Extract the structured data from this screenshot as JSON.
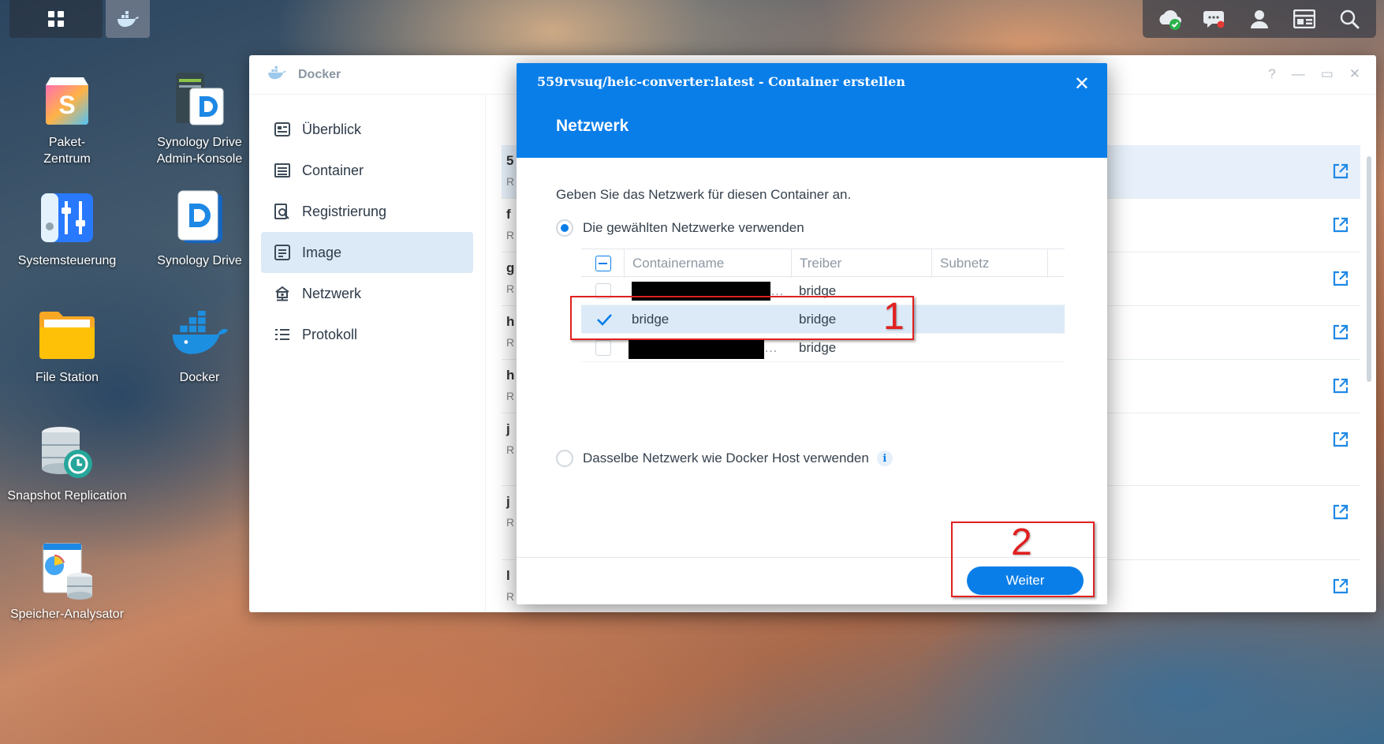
{
  "taskbar": {
    "icons": [
      "apps-grid-icon",
      "docker-app-icon",
      "cloud-sync-icon",
      "chat-notification-icon",
      "user-icon",
      "widgets-icon",
      "search-icon"
    ]
  },
  "desktop": {
    "icons": [
      {
        "label": "Paket-\nZentrum"
      },
      {
        "label": "Synology Drive\nAdmin-Konsole"
      },
      {
        "label": "Systemsteuerung"
      },
      {
        "label": "Synology Drive"
      },
      {
        "label": "File Station"
      },
      {
        "label": "Docker"
      },
      {
        "label": "Snapshot Replication"
      },
      {
        "label": "Speicher-Analysator"
      }
    ]
  },
  "docker_window": {
    "title": "Docker",
    "controls": [
      "?",
      "—",
      "▭",
      "✕"
    ],
    "sidebar": [
      {
        "label": "Überblick"
      },
      {
        "label": "Container"
      },
      {
        "label": "Registrierung"
      },
      {
        "label": "Image"
      },
      {
        "label": "Netzwerk"
      },
      {
        "label": "Protokoll"
      }
    ],
    "rows": [
      {
        "l1": "5",
        "l2": "R"
      },
      {
        "l1": "f",
        "l2": "R"
      },
      {
        "l1": "g",
        "l2": "R"
      },
      {
        "l1": "h",
        "l2": "R"
      },
      {
        "l1": "h",
        "l2": "R"
      },
      {
        "l1": "j",
        "l2": "R"
      },
      {
        "l1": "j",
        "l2": "R"
      },
      {
        "l1": "l",
        "l2": "R"
      }
    ]
  },
  "modal": {
    "title": "559rvsuq/heic-converter:latest - Container erstellen",
    "close": "✕",
    "subtitle": "Netzwerk",
    "description": "Geben Sie das Netzwerk für diesen Container an.",
    "option_selected": "Die gewählten Netzwerke verwenden",
    "option_host": "Dasselbe Netzwerk wie Docker Host verwenden",
    "info": "i",
    "table": {
      "headers": [
        "Containername",
        "Treiber",
        "Subnetz"
      ],
      "rows": [
        {
          "name": "…",
          "driver": "bridge",
          "subnet": "",
          "checked": false
        },
        {
          "name": "bridge",
          "driver": "bridge",
          "subnet": "",
          "checked": true
        },
        {
          "name": "…",
          "driver": "bridge",
          "subnet": "",
          "checked": false
        }
      ]
    },
    "next_button": "Weiter"
  },
  "annotations": {
    "one": "1",
    "two": "2"
  },
  "colors": {
    "accent": "#0a7ee8",
    "annotation": "#e12020"
  }
}
